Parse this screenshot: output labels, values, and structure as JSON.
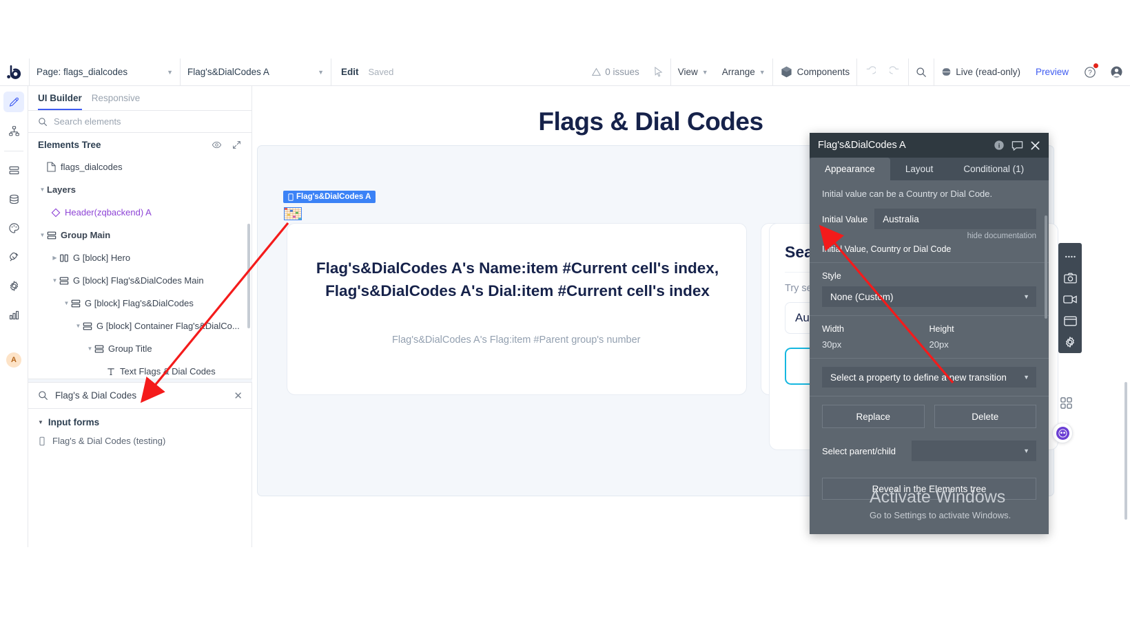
{
  "topbar": {
    "logo": "b",
    "page_select": "Page: flags_dialcodes",
    "element_select": "Flag's&DialCodes A",
    "edit": "Edit",
    "saved": "Saved",
    "issues": "0 issues",
    "view": "View",
    "arrange": "Arrange",
    "components": "Components",
    "live": "Live (read-only)",
    "preview": "Preview"
  },
  "left_panel": {
    "tabs": [
      {
        "label": "UI Builder",
        "active": true
      },
      {
        "label": "Responsive",
        "active": false
      }
    ],
    "search_placeholder": "Search elements",
    "elements_tree_title": "Elements Tree",
    "tree": [
      {
        "label": "flags_dialcodes",
        "icon": "page-icon",
        "indent": 0,
        "arrow": "",
        "kind": "page"
      },
      {
        "label": "Layers",
        "icon": "",
        "indent": 0,
        "arrow": "down",
        "kind": "bold"
      },
      {
        "label": "Header(zqbackend) A",
        "icon": "diamond-icon",
        "indent": 1,
        "arrow": "",
        "kind": "component"
      },
      {
        "label": "Group Main",
        "icon": "group-icon",
        "indent": 0,
        "arrow": "down",
        "kind": "group"
      },
      {
        "label": "G [block] Hero",
        "icon": "columns-icon",
        "indent": 1,
        "arrow": "right",
        "kind": "group"
      },
      {
        "label": "G [block] Flag's&DialCodes Main",
        "icon": "group-icon",
        "indent": 1,
        "arrow": "down",
        "kind": "group"
      },
      {
        "label": "G [block] Flag's&DialCodes",
        "icon": "group-icon",
        "indent": 2,
        "arrow": "down",
        "kind": "group"
      },
      {
        "label": "G [block] Container Flag's&DialCo...",
        "icon": "group-icon",
        "indent": 3,
        "arrow": "down",
        "kind": "group"
      },
      {
        "label": "Group Title",
        "icon": "group-icon",
        "indent": 4,
        "arrow": "down",
        "kind": "group"
      },
      {
        "label": "Text Flags & Dial Codes",
        "icon": "text-icon",
        "indent": 5,
        "arrow": "",
        "kind": "text"
      }
    ],
    "element_search_value": "Flag's & Dial Codes",
    "results_group": "Input forms",
    "results": [
      {
        "label": "Flag's & Dial Codes (testing)",
        "icon": "plugin-icon"
      }
    ]
  },
  "rail": {
    "items": [
      {
        "name": "design-icon",
        "active": true
      },
      {
        "name": "workflow-icon",
        "active": false
      },
      {
        "name": "data-icon",
        "active": false
      },
      {
        "name": "database-icon",
        "active": false
      },
      {
        "name": "styles-icon",
        "active": false
      },
      {
        "name": "plugins-icon",
        "active": false
      },
      {
        "name": "settings-icon",
        "active": false
      },
      {
        "name": "logs-icon",
        "active": false
      }
    ],
    "avatar": "A"
  },
  "canvas": {
    "page_title": "Flags & Dial Codes",
    "selection_badge": "Flag's&DialCodes A",
    "card_left_heading": "Flag's&DialCodes A's Name:item #Current cell's index, Flag's&DialCodes A's Dial:item #Current cell's index",
    "card_left_sub": "Flag's&DialCodes A's Flag:item #Parent group's number",
    "card_right_title": "Search",
    "card_right_sub": "Try searching",
    "card_right_input": "Australia"
  },
  "properties": {
    "title": "Flag's&DialCodes A",
    "tabs": [
      {
        "label": "Appearance",
        "active": true
      },
      {
        "label": "Layout",
        "active": false
      },
      {
        "label": "Conditional (1)",
        "active": false
      }
    ],
    "note": "Initial value can be a Country or Dial Code.",
    "initial_value_label": "Initial Value",
    "initial_value": "Australia",
    "hide_documentation": "hide documentation",
    "initial_value_caption": "Initial Value, Country or Dial Code",
    "style_label": "Style",
    "style_value": "None (Custom)",
    "width_label": "Width",
    "width_value": "30px",
    "height_label": "Height",
    "height_value": "20px",
    "transition_placeholder": "Select a property to define a new transition",
    "replace_label": "Replace",
    "delete_label": "Delete",
    "parent_child_label": "Select parent/child",
    "reveal_label": "Reveal in the Elements tree"
  },
  "watermark": {
    "line1": "Activate Windows",
    "line2": "Go to Settings to activate Windows."
  },
  "colors": {
    "accent": "#3d5af1",
    "selection": "#3b82f6",
    "panel_bg": "#5d666f",
    "panel_head": "#2f3940",
    "arrow": "#f41b1b"
  }
}
